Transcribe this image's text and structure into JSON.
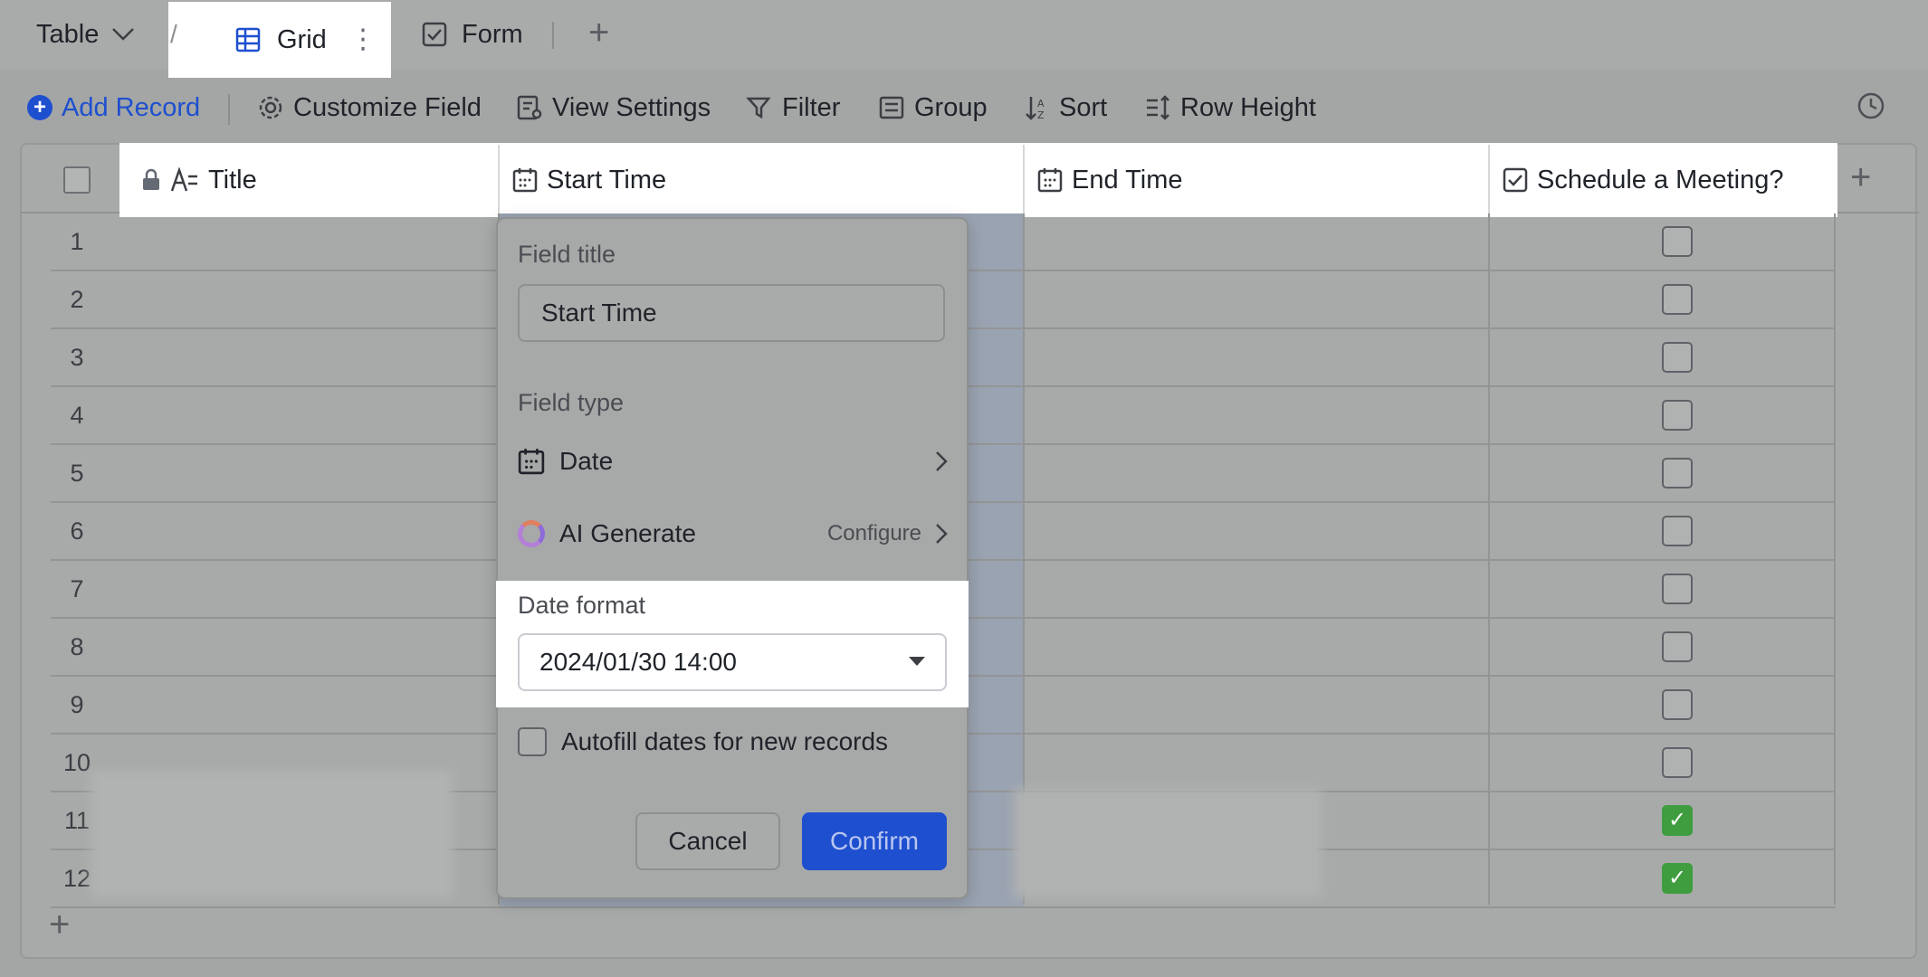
{
  "tabs": {
    "table_label": "Table",
    "separator": "/",
    "grid_label": "Grid",
    "form_label": "Form",
    "more": "⋮",
    "add": "+"
  },
  "toolbar": {
    "add_record": "Add Record",
    "customize_field": "Customize Field",
    "view_settings": "View Settings",
    "filter": "Filter",
    "group": "Group",
    "sort": "Sort",
    "row_height": "Row Height"
  },
  "columns": {
    "title": "Title",
    "start_time": "Start Time",
    "end_time": "End Time",
    "schedule": "Schedule a Meeting?",
    "add": "+"
  },
  "rows": [
    {
      "num": "1",
      "checked": false
    },
    {
      "num": "2",
      "checked": false
    },
    {
      "num": "3",
      "checked": false
    },
    {
      "num": "4",
      "checked": false
    },
    {
      "num": "5",
      "checked": false
    },
    {
      "num": "6",
      "checked": false
    },
    {
      "num": "7",
      "checked": false
    },
    {
      "num": "8",
      "checked": false
    },
    {
      "num": "9",
      "checked": false
    },
    {
      "num": "10",
      "checked": false
    },
    {
      "num": "11",
      "checked": true
    },
    {
      "num": "12",
      "checked": true
    }
  ],
  "add_row": "+",
  "panel": {
    "field_title_label": "Field title",
    "field_title_value": "Start Time",
    "field_type_label": "Field type",
    "field_type_value": "Date",
    "ai_label": "AI Generate",
    "ai_configure": "Configure",
    "date_format_label": "Date format",
    "date_format_value": "2024/01/30 14:00",
    "autofill_label": "Autofill dates for new records",
    "cancel": "Cancel",
    "confirm": "Confirm"
  },
  "colors": {
    "accent": "#1e4fcf",
    "checked_green": "#3f9d3f",
    "overlay_gray": "#a4a6a5"
  },
  "icons": [
    "chevron-down-icon",
    "grid-icon",
    "form-icon",
    "plus-icon",
    "circle-plus-icon",
    "gear-icon",
    "view-settings-icon",
    "filter-icon",
    "group-icon",
    "sort-icon",
    "row-height-icon",
    "history-icon",
    "lock-icon",
    "text-field-icon",
    "calendar-icon",
    "checkbox-field-icon",
    "chevron-right-icon",
    "ai-generate-icon",
    "caret-down-icon"
  ]
}
